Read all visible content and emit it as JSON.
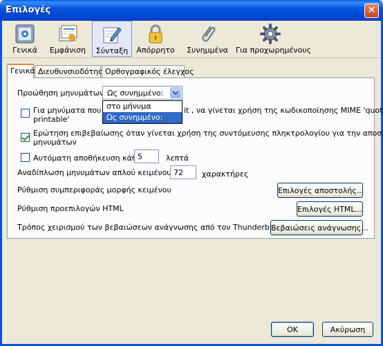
{
  "window": {
    "title": "Επιλογές",
    "close_glyph": "✕"
  },
  "toolbar": {
    "items": [
      {
        "label": "Γενικά",
        "icon": "general-settings-icon"
      },
      {
        "label": "Εμφάνιση",
        "icon": "display-icon"
      },
      {
        "label": "Σύνταξη",
        "icon": "composition-icon",
        "active": true
      },
      {
        "label": "Απόρρητο",
        "icon": "lock-icon"
      },
      {
        "label": "Συνημμένα",
        "icon": "paperclip-icon"
      },
      {
        "label": "Για προχωρημένους",
        "icon": "gear-icon"
      }
    ]
  },
  "tabs": [
    {
      "label": "Γενικά",
      "active": true
    },
    {
      "label": "Διευθυνσιοδότηση"
    },
    {
      "label": "Ορθογραφικός έλεγχος"
    }
  ],
  "general": {
    "forward_label": "Προώθηση μηνυμάτων:",
    "forward_select": {
      "value": "Ως συνημμένο:",
      "options": [
        "στο μήνυμα",
        "Ως συνημμένο:"
      ],
      "selected_index": 1
    },
    "mime_line1_start": "Για μηνύματα που πε",
    "mime_line1_end": "it , να γίνεται χρήση της κωδικοποίησης MIME 'quoted",
    "mime_line2": "printable'",
    "mime_checked": false,
    "shortcut_line1": "Ερώτηση επιβεβαίωσης όταν γίνεται χρήση της συντόμευσης πληκτρολογίου για την αποστολή",
    "shortcut_line2": "μηνυμάτων",
    "shortcut_checked": true,
    "autosave_label": "Αυτόματη αποθήκευση κάθε",
    "autosave_value": "5",
    "autosave_unit": "λεπτά",
    "autosave_checked": false,
    "wrap_label": "Αναδίπλωση μηνυμάτων απλού κειμένου σε",
    "wrap_value": "72",
    "wrap_unit": "χαρακτήρες",
    "text_format_label": "Ρύθμιση συμπεριφοράς μορφής κειμένου",
    "send_options_button": "Επιλογές αποστολής...",
    "html_label": "Ρύθμιση προεπιλογών HTML",
    "html_options_button": "Επιλογές HTML...",
    "receipts_label": "Τρόπος χειρισμού των βεβαιώσεων ανάγνωσης από τον Thunderbird",
    "receipts_button": "Βεβαιώσεις ανάγνωσης..."
  },
  "footer": {
    "ok": "OK",
    "cancel": "Ακύρωση"
  }
}
